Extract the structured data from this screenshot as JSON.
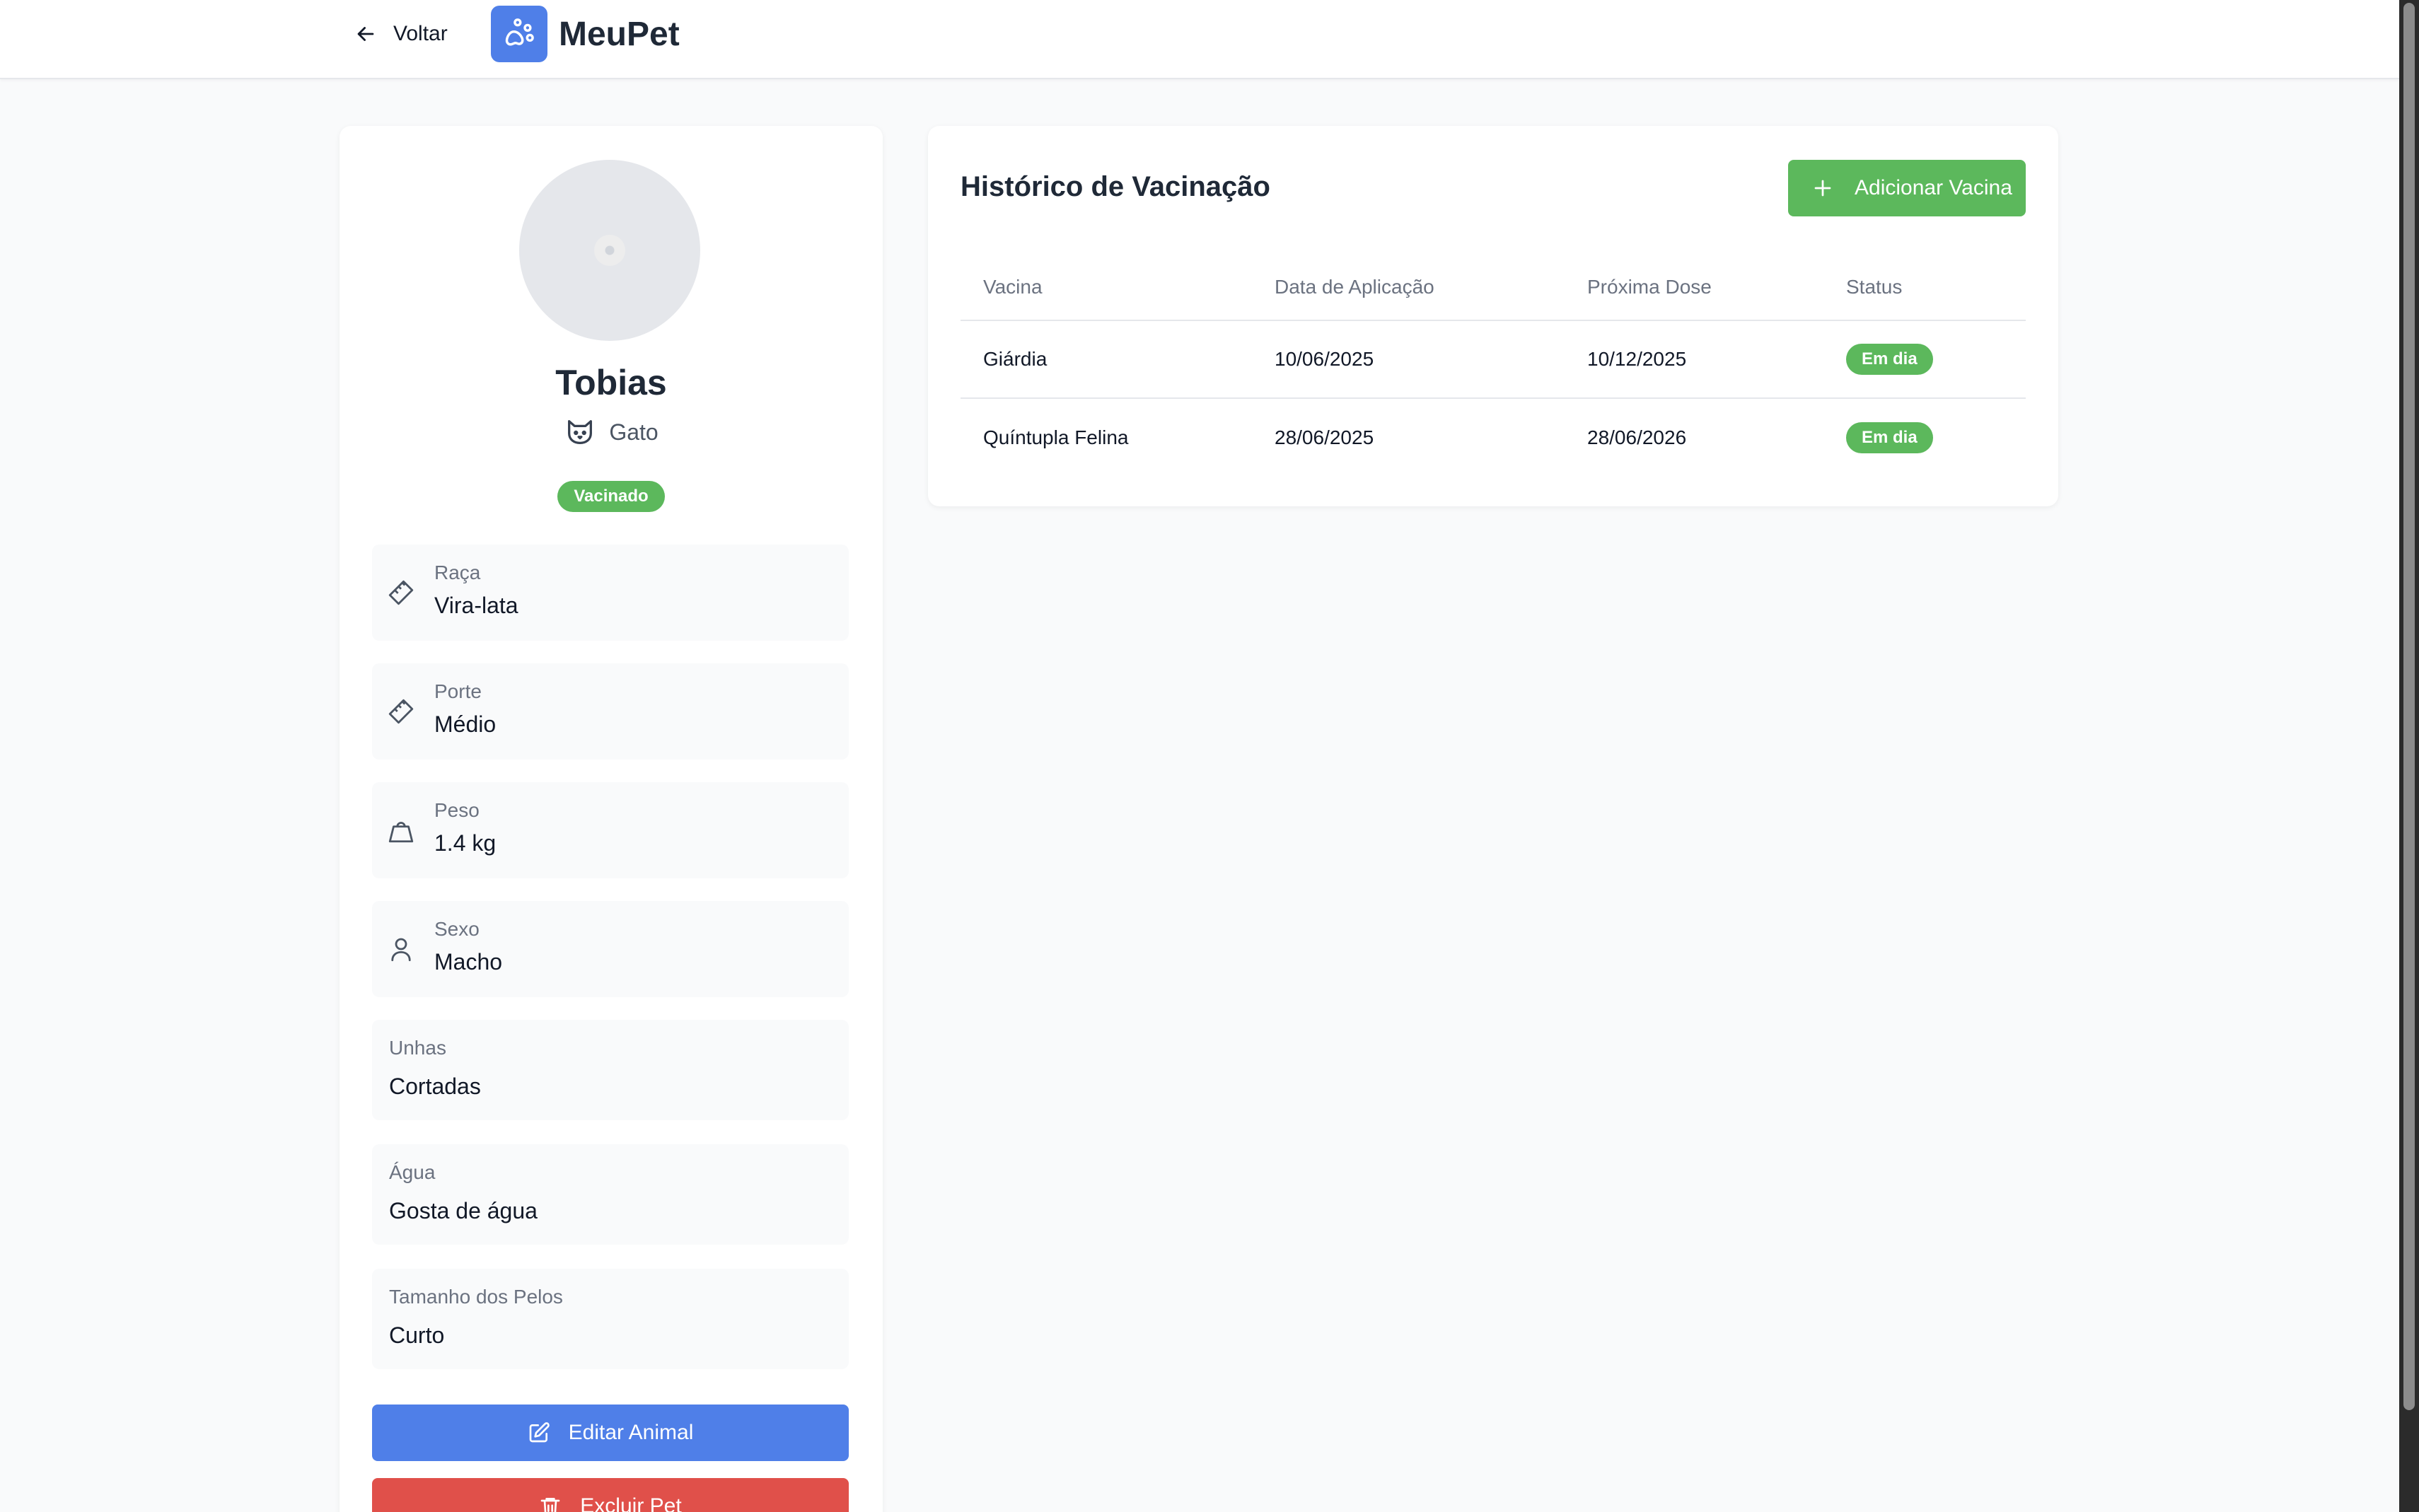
{
  "header": {
    "back_label": "Voltar",
    "brand": "MeuPet"
  },
  "pet": {
    "name": "Tobias",
    "species": "Gato",
    "badge": "Vacinado",
    "fields": [
      {
        "label": "Raça",
        "value": "Vira-lata",
        "icon": "ruler-icon"
      },
      {
        "label": "Porte",
        "value": "Médio",
        "icon": "ruler-icon"
      },
      {
        "label": "Peso",
        "value": "1.4 kg",
        "icon": "weight-icon"
      },
      {
        "label": "Sexo",
        "value": "Macho",
        "icon": "user-icon"
      },
      {
        "label": "Unhas",
        "value": "Cortadas"
      },
      {
        "label": "Água",
        "value": "Gosta de água"
      },
      {
        "label": "Tamanho dos Pelos",
        "value": "Curto"
      }
    ],
    "edit_label": "Editar Animal",
    "delete_label": "Excluir Pet"
  },
  "vaccines": {
    "title": "Histórico de Vacinação",
    "add_label": "Adicionar Vacina",
    "columns": [
      "Vacina",
      "Data de Aplicação",
      "Próxima Dose",
      "Status"
    ],
    "rows": [
      {
        "name": "Giárdia",
        "applied": "10/06/2025",
        "next": "10/12/2025",
        "status": "Em dia"
      },
      {
        "name": "Quíntupla Felina",
        "applied": "28/06/2025",
        "next": "28/06/2026",
        "status": "Em dia"
      }
    ]
  },
  "colors": {
    "primary": "#4f7fe8",
    "success": "#5cb85c",
    "danger": "#e0504a"
  }
}
